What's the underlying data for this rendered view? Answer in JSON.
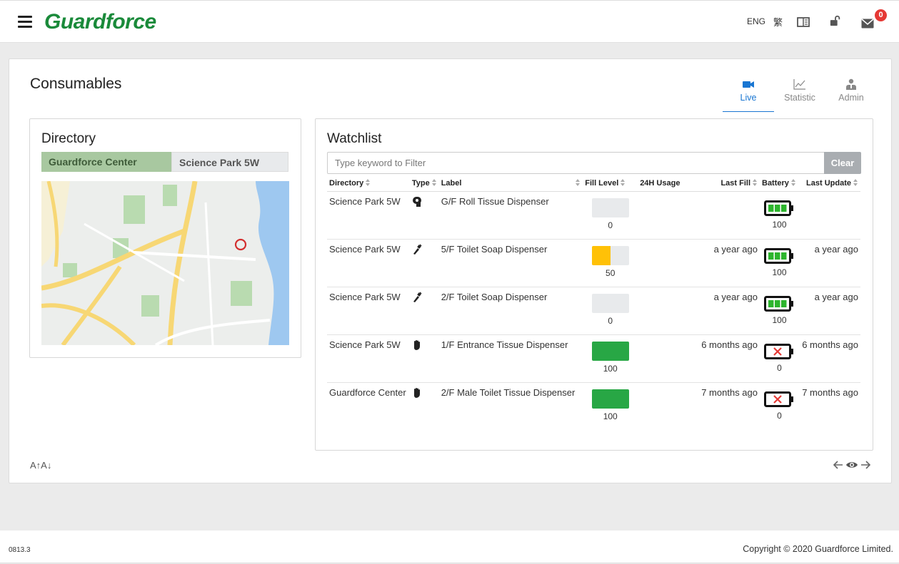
{
  "header": {
    "logo": "Guardforce",
    "lang_en": "ENG",
    "lang_tc": "繁",
    "notification_count": "0"
  },
  "page": {
    "title": "Consumables",
    "tabs": [
      {
        "label": "Live",
        "icon": "video-camera-icon",
        "active": true
      },
      {
        "label": "Statistic",
        "icon": "line-chart-icon",
        "active": false
      },
      {
        "label": "Admin",
        "icon": "admin-user-icon",
        "active": false
      }
    ]
  },
  "directory": {
    "title": "Directory",
    "tabs": [
      {
        "label": "Guardforce Center",
        "active": true
      },
      {
        "label": "Science Park 5W",
        "active": false
      }
    ]
  },
  "watchlist": {
    "title": "Watchlist",
    "filter_placeholder": "Type keyword to Filter",
    "filter_value": "",
    "clear_label": "Clear",
    "columns": [
      "Directory",
      "Type",
      "Label",
      "Fill Level",
      "24H Usage",
      "Last Fill",
      "Battery",
      "Last Update"
    ],
    "rows": [
      {
        "directory": "Science Park 5W",
        "type": "roll-tissue-icon",
        "label": "G/F Roll Tissue Dispenser",
        "fill": 0,
        "fill_text": "0",
        "usage": "",
        "last_fill": "",
        "battery": 100,
        "battery_text": "100",
        "last_update": ""
      },
      {
        "directory": "Science Park 5W",
        "type": "soap-icon",
        "label": "5/F Toilet Soap Dispenser",
        "fill": 50,
        "fill_text": "50",
        "usage": "",
        "last_fill": "a year ago",
        "battery": 100,
        "battery_text": "100",
        "last_update": "a year ago"
      },
      {
        "directory": "Science Park 5W",
        "type": "soap-icon",
        "label": "2/F Toilet Soap Dispenser",
        "fill": 0,
        "fill_text": "0",
        "usage": "",
        "last_fill": "a year ago",
        "battery": 100,
        "battery_text": "100",
        "last_update": "a year ago"
      },
      {
        "directory": "Science Park 5W",
        "type": "hand-tissue-icon",
        "label": "1/F Entrance Tissue Dispenser",
        "fill": 100,
        "fill_text": "100",
        "usage": "",
        "last_fill": "6 months ago",
        "battery": 0,
        "battery_text": "0",
        "last_update": "6 months ago"
      },
      {
        "directory": "Guardforce Center",
        "type": "hand-tissue-icon",
        "label": "2/F Male Toilet Tissue Dispenser",
        "fill": 100,
        "fill_text": "100",
        "usage": "",
        "last_fill": "7 months ago",
        "battery": 0,
        "battery_text": "0",
        "last_update": "7 months ago"
      }
    ]
  },
  "font_controls": "A↑A↓",
  "footer": {
    "version": "0813.3",
    "copyright": "Copyright © 2020 Guardforce Limited."
  },
  "colors": {
    "brand_green": "#1a8a3a",
    "accent_blue": "#1976d2",
    "fill_full": "#28a745",
    "fill_half": "#ffc107",
    "battery_ok": "#2db52d",
    "battery_dead": "#e53935"
  }
}
